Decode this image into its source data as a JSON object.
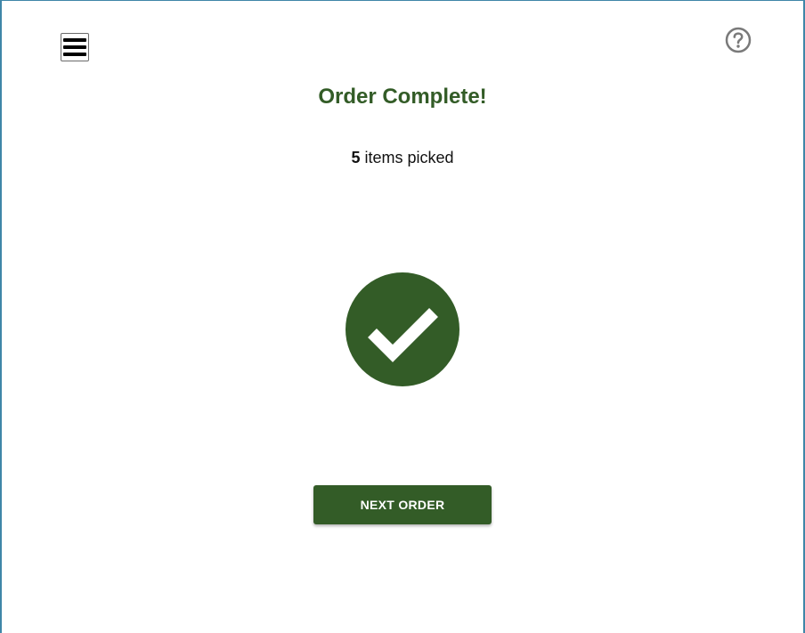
{
  "header": {
    "menu_icon": "hamburger-menu-icon",
    "help_icon": "question-circle-icon"
  },
  "main": {
    "title": "Order Complete!",
    "items_count": "5",
    "items_label": " items picked",
    "status_icon": "check-circle-icon",
    "next_button_label": "NEXT ORDER"
  },
  "colors": {
    "primary_green": "#335c27",
    "help_icon_gray": "#7a7a7a",
    "frame_border": "#3f86a8"
  }
}
